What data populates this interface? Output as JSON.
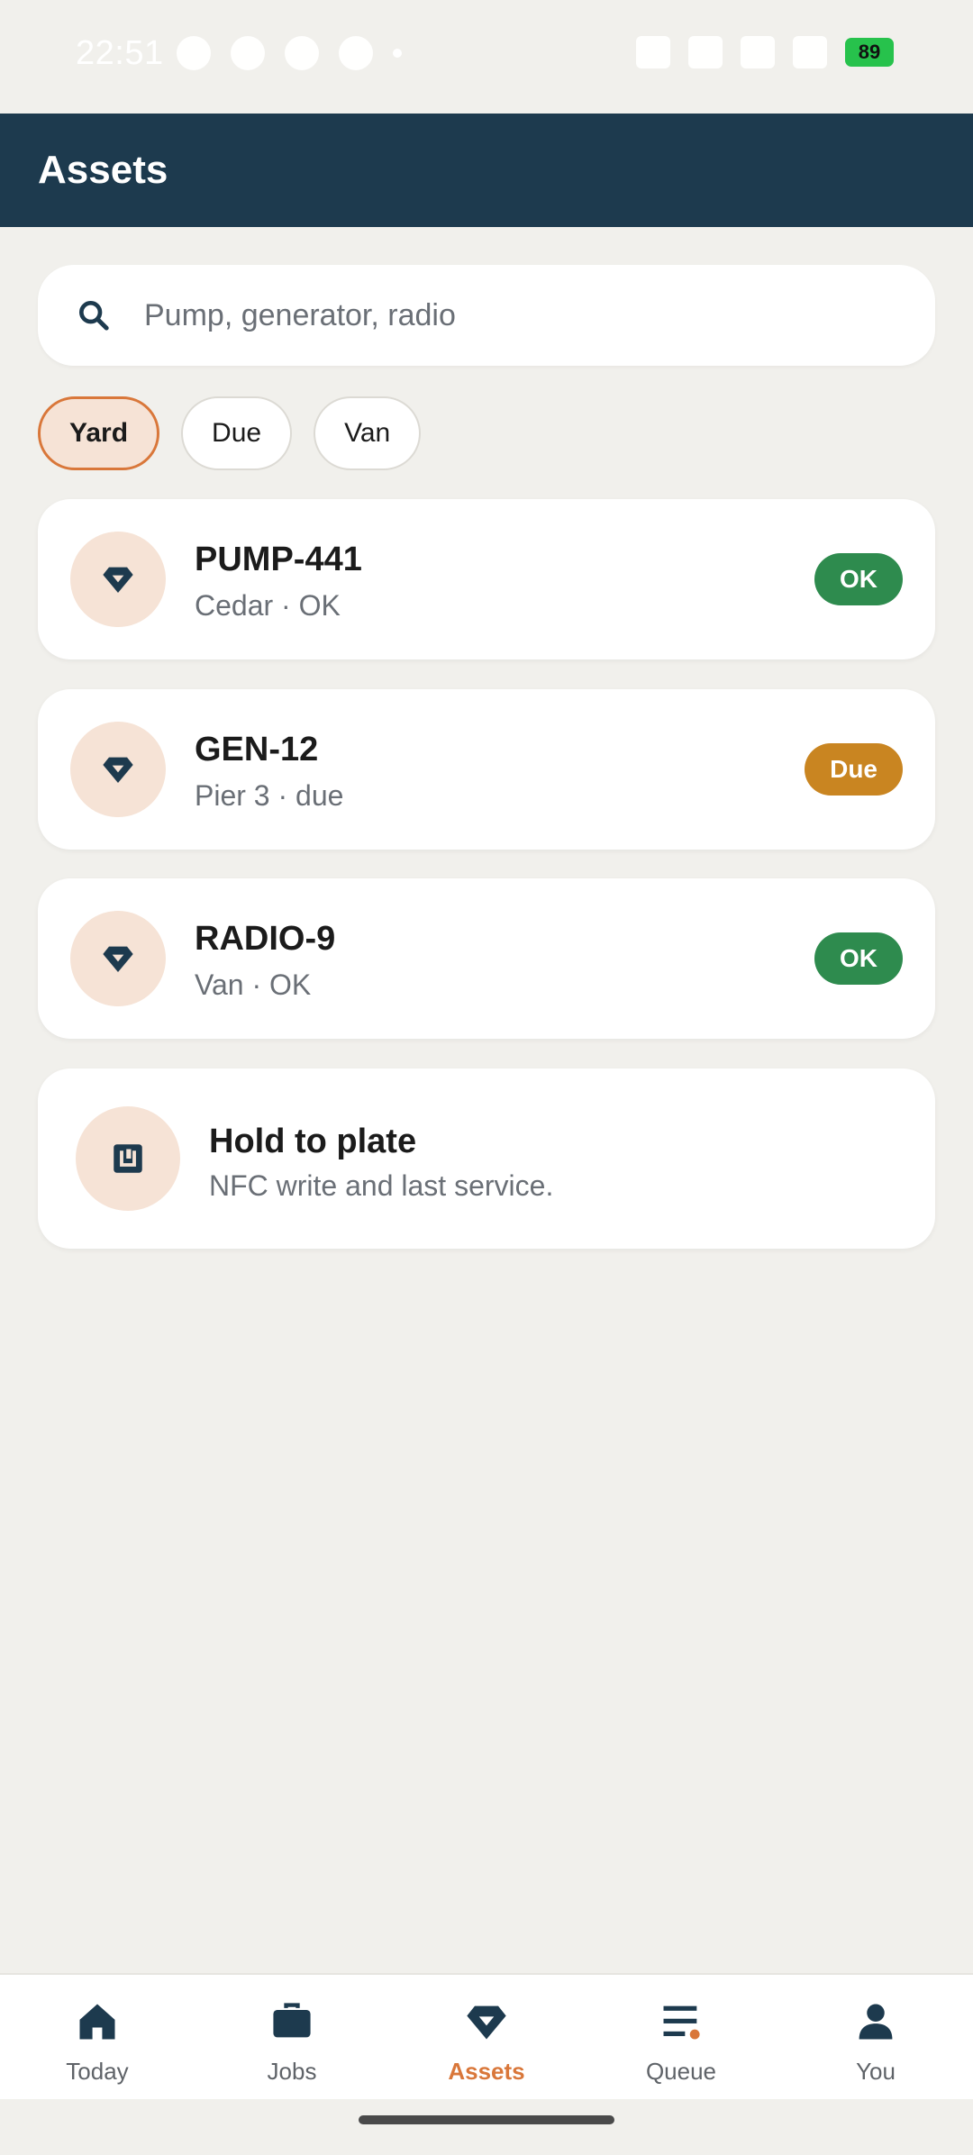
{
  "status_bar": {
    "time": "22:51",
    "battery": "89"
  },
  "header": {
    "title": "Assets"
  },
  "search": {
    "placeholder": "Pump, generator, radio",
    "icon": "search-icon"
  },
  "filters": [
    {
      "label": "Yard",
      "active": true
    },
    {
      "label": "Due",
      "active": false
    },
    {
      "label": "Van",
      "active": false
    }
  ],
  "assets": [
    {
      "name": "PUMP-441",
      "subtitle": "Cedar · OK",
      "status": "OK",
      "status_color": "#2e8b4e"
    },
    {
      "name": "GEN-12",
      "subtitle": "Pier 3 · due",
      "status": "Due",
      "status_color": "#c98521"
    },
    {
      "name": "RADIO-9",
      "subtitle": "Van · OK",
      "status": "OK",
      "status_color": "#2e8b4e"
    }
  ],
  "nfc": {
    "title": "Hold to plate",
    "subtitle": "NFC write and last service."
  },
  "bottom_nav": [
    {
      "label": "Today",
      "icon": "home-icon"
    },
    {
      "label": "Jobs",
      "icon": "briefcase-icon"
    },
    {
      "label": "Assets",
      "icon": "gem-icon",
      "active": true
    },
    {
      "label": "Queue",
      "icon": "queue-icon"
    },
    {
      "label": "You",
      "icon": "person-icon"
    }
  ],
  "colors": {
    "header_bg": "#1d3a4e",
    "accent": "#d9773a",
    "ok": "#2e8b4e",
    "due": "#c98521",
    "background": "#f1f0ec"
  }
}
